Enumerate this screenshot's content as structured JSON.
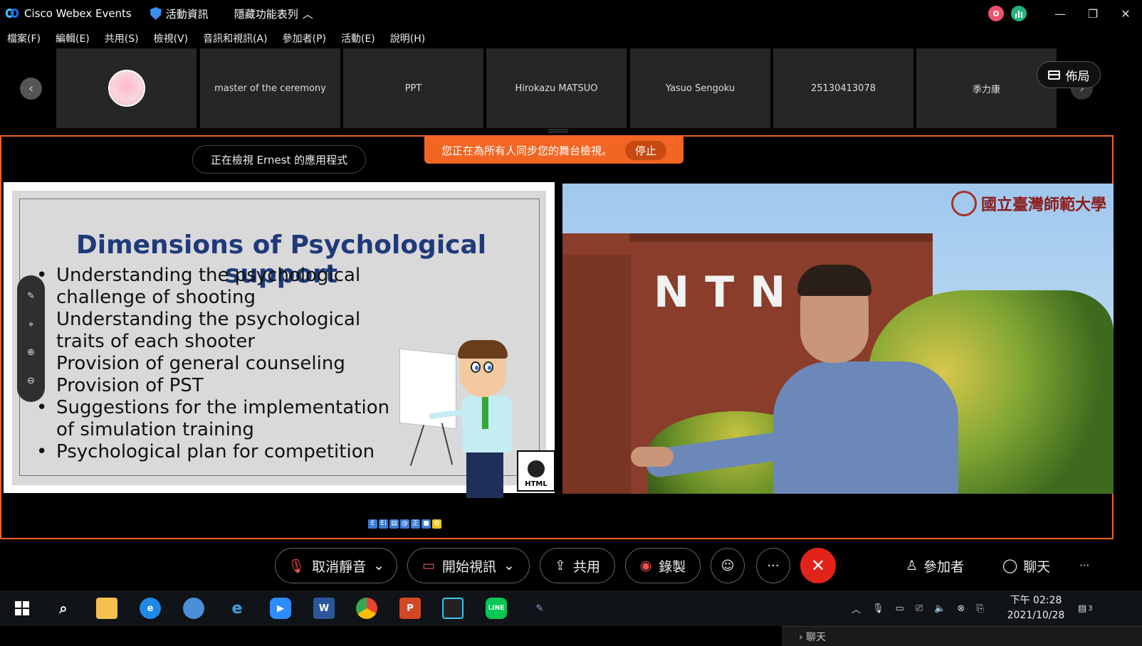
{
  "titlebar": {
    "app_name": "Cisco Webex Events",
    "event_info": "活動資訊",
    "hide_menu": "隱藏功能表列",
    "chevron_up": "︿",
    "minimize": "—",
    "restore": "❐",
    "close": "✕"
  },
  "menu": [
    "檔案(F)",
    "編輯(E)",
    "共用(S)",
    "檢視(V)",
    "音訊和視訊(A)",
    "參加者(P)",
    "活動(E)",
    "說明(H)"
  ],
  "strip": {
    "prev": "‹",
    "next": "›",
    "tiles": [
      "master of the ceremony",
      "PPT",
      "Hirokazu MATSUO",
      "Yasuo Sengoku",
      "25130413078",
      "季力康"
    ],
    "layout_label": "佈局"
  },
  "stage": {
    "viewing_label": "正在檢視 Ernest 的應用程式",
    "sync_message": "您正在為所有人同步您的舞台檢視。",
    "stop_label": "停止"
  },
  "slide": {
    "title": "Dimensions of Psychological support",
    "bullets": [
      "Understanding the psychological challenge of shooting",
      "Understanding the psychological traits of each shooter",
      "Provision of general counseling",
      "Provision of PST",
      "Suggestions for the implementation of simulation training",
      "Psychological plan for competition"
    ],
    "badge_text": "HTML",
    "tools": [
      "✎",
      "⌖",
      "⊕",
      "⊖"
    ],
    "ime": [
      "E",
      "Ei",
      "▤",
      "@",
      "正",
      "■",
      "✿"
    ]
  },
  "video": {
    "sign": "NTNU",
    "crest_text": "國立臺灣師範大學"
  },
  "controls": {
    "mute": "取消靜音",
    "video": "開始視訊",
    "share": "共用",
    "record": "錄製",
    "reactions": "☺",
    "more": "···",
    "end": "✕",
    "participants": "參加者",
    "chat": "聊天",
    "overflow": "···"
  },
  "taskbar": {
    "time": "下午 02:28",
    "date": "2021/10/28",
    "notification_count": "3"
  },
  "under": {
    "chat_peek": "› 聊天"
  },
  "colors": {
    "accent_orange": "#f26522",
    "end_red": "#e2231a",
    "slide_title": "#1f3a7a"
  }
}
